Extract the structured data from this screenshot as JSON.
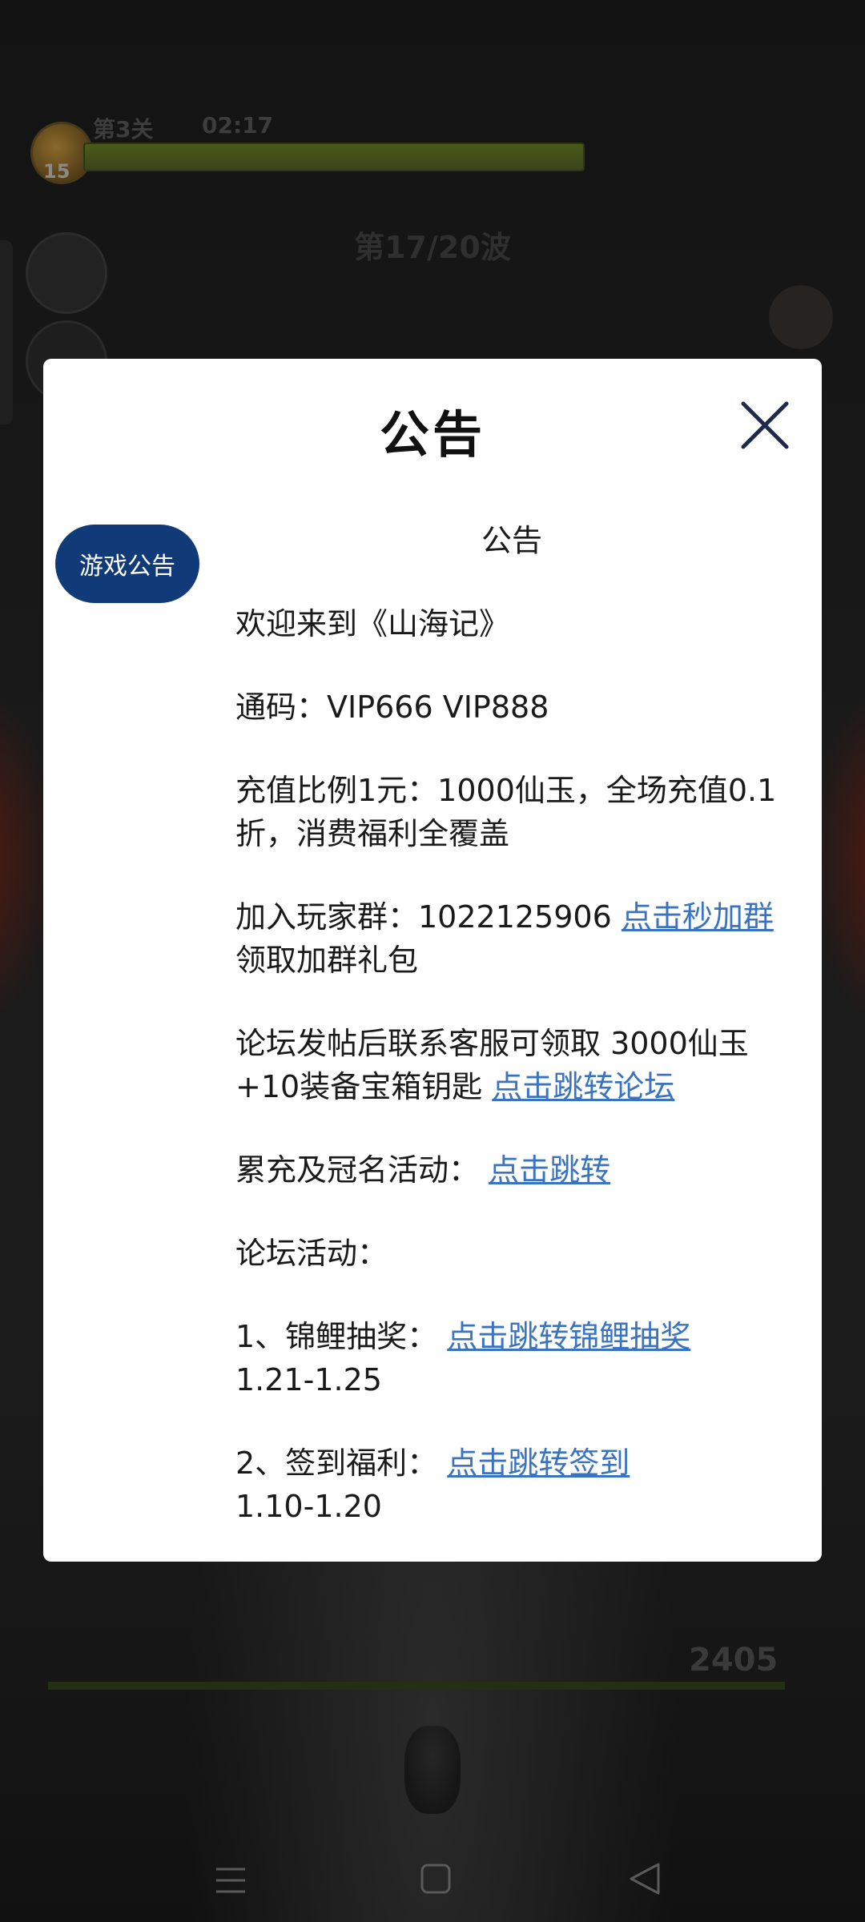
{
  "game": {
    "level_badge": "15",
    "stage": "第3关",
    "timer": "02:17",
    "wave": "第17/20波",
    "score": "2405"
  },
  "dialog": {
    "title": "公告",
    "tab_label": "游戏公告",
    "content_title": "公告",
    "welcome": "欢迎来到《山海记》",
    "codes": "通码：VIP666 VIP888",
    "recharge": "充值比例1元：1000仙玉，全场充值0.1折，消费福利全覆盖",
    "group_prefix": "加入玩家群：1022125906 ",
    "group_link": "点击秒加群",
    "group_suffix": " 领取加群礼包",
    "forum_text": "论坛发帖后联系客服可领取 3000仙玉+10装备宝箱钥匙 ",
    "forum_link": "点击跳转论坛",
    "event_prefix": "累充及冠名活动： ",
    "event_link": "点击跳转",
    "forum_events_title": "论坛活动：",
    "item1_prefix": "1、锦鲤抽奖： ",
    "item1_link": "点击跳转锦鲤抽奖",
    "item1_dates": "1.21-1.25",
    "item2_prefix": "2、签到福利： ",
    "item2_link": "点击跳转签到",
    "item2_dates": "1.10-1.20"
  },
  "colors": {
    "tab_bg": "#103a78",
    "link": "#3a73c0"
  },
  "icons": {
    "close": "close-icon",
    "nav_menu": "menu-icon",
    "nav_home": "home-icon",
    "nav_back": "back-icon"
  }
}
